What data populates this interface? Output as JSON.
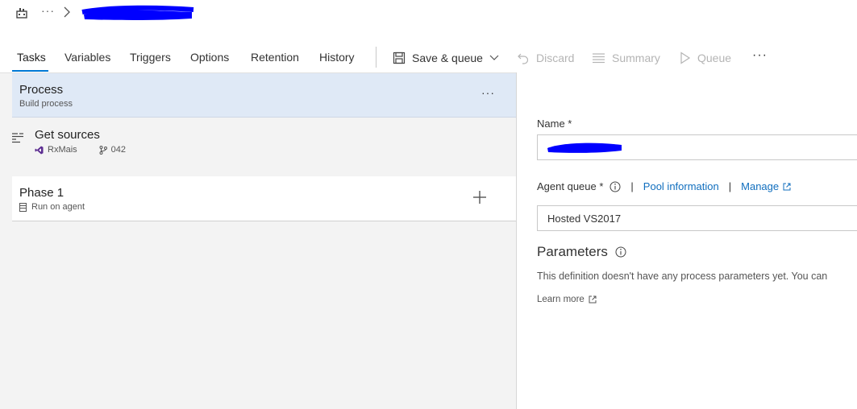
{
  "breadcrumb": {
    "ellipsis": "···",
    "icon": "build-pipeline-icon"
  },
  "tabs": [
    {
      "label": "Tasks",
      "active": true
    },
    {
      "label": "Variables",
      "active": false
    },
    {
      "label": "Triggers",
      "active": false
    },
    {
      "label": "Options",
      "active": false
    },
    {
      "label": "Retention",
      "active": false
    },
    {
      "label": "History",
      "active": false
    }
  ],
  "commands": {
    "save_queue": "Save & queue",
    "discard": "Discard",
    "summary": "Summary",
    "queue": "Queue",
    "more": "···"
  },
  "process": {
    "title": "Process",
    "subtitle": "Build process",
    "more": "···"
  },
  "get_sources": {
    "title": "Get sources",
    "repo": "RxMais",
    "branch": "042"
  },
  "phase": {
    "title": "Phase 1",
    "subtitle": "Run on agent"
  },
  "details": {
    "name_label": "Name *",
    "agent_queue_label": "Agent queue *",
    "pool_information": "Pool information",
    "manage": "Manage",
    "agent_queue_value": "Hosted VS2017",
    "parameters_title": "Parameters",
    "parameters_text": "This definition doesn't have any process parameters yet. You can",
    "learn_more": "Learn more"
  },
  "colors": {
    "accent": "#0078d4",
    "selected_row": "#dfe9f6",
    "redaction": "#0000ff"
  }
}
